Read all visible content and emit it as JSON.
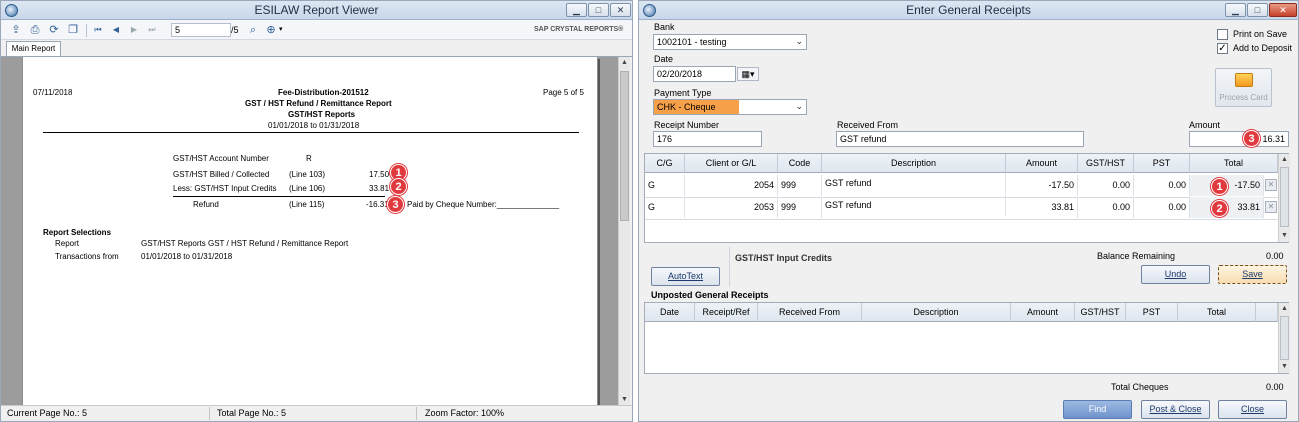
{
  "viewer": {
    "title": "ESILAW Report Viewer",
    "toolbar": {
      "page_input": "5",
      "page_total": "/5",
      "brand": "SAP CRYSTAL REPORTS®"
    },
    "tab": "Main Report",
    "report": {
      "date": "07/11/2018",
      "doc_id": "Fee-Distribution-201512",
      "page_label": "Page 5 of 5",
      "title1": "GST / HST Refund / Remittance  Report",
      "title2": "GST/HST Reports",
      "range": "01/01/2018  to  01/31/2018",
      "account_label": "GST/HST Account Number",
      "account_value": "R",
      "lines": [
        {
          "label": "GST/HST Billed / Collected",
          "line": "(Line 103)",
          "amount": "17.50",
          "badge": "1"
        },
        {
          "label": "Less: GST/HST Input Credits",
          "line": "(Line 106)",
          "amount": "33.81",
          "badge": "2"
        },
        {
          "label": "Refund",
          "line": "(Line 115)",
          "amount": "-16.31",
          "badge": "3"
        }
      ],
      "paid_text": "Paid by Cheque Number:______________",
      "selections_heading": "Report Selections",
      "sel_report_label": "Report",
      "sel_report_value": "GST/HST Reports    GST / HST Refund / Remittance  Report",
      "sel_trans_label": "Transactions from",
      "sel_trans_value": "01/01/2018  to  01/31/2018"
    },
    "status": {
      "current": "Current Page No.: 5",
      "total": "Total Page No.: 5",
      "zoom": "Zoom Factor: 100%"
    }
  },
  "receipts": {
    "title": "Enter General Receipts",
    "bank_label": "Bank",
    "bank_value": "1002101 - testing",
    "date_label": "Date",
    "date_value": "02/20/2018",
    "payment_label": "Payment Type",
    "payment_value": "CHK - Cheque",
    "print_on_save": "Print on Save",
    "add_to_deposit": "Add to Deposit",
    "process_card": "Process Card",
    "receipt_number_label": "Receipt Number",
    "receipt_number_value": "176",
    "received_from_label": "Received From",
    "received_from_value": "GST refund",
    "amount_label": "Amount",
    "amount_value": "16.31",
    "amount_badge": "3",
    "grid": {
      "headers": [
        "C/G",
        "Client or G/L",
        "Code",
        "Description",
        "Amount",
        "GST/HST",
        "PST",
        "Total"
      ],
      "rows": [
        {
          "cg": "G",
          "client": "2054",
          "code": "999",
          "desc": "GST refund",
          "amount": "-17.50",
          "gst": "0.00",
          "pst": "0.00",
          "total": "-17.50",
          "badge": "1"
        },
        {
          "cg": "G",
          "client": "2053",
          "code": "999",
          "desc": "GST refund",
          "amount": "33.81",
          "gst": "0.00",
          "pst": "0.00",
          "total": "33.81",
          "badge": "2"
        }
      ]
    },
    "gst_input_credits": "GST/HST Input Credits",
    "balance_label": "Balance Remaining",
    "balance_value": "0.00",
    "autotext": "AutoText",
    "undo": "Undo",
    "save": "Save",
    "unposted_label": "Unposted General Receipts",
    "unposted_headers": [
      "Date",
      "Receipt/Ref",
      "Received From",
      "Description",
      "Amount",
      "GST/HST",
      "PST",
      "Total"
    ],
    "total_cheques_label": "Total Cheques",
    "total_cheques_value": "0.00",
    "find": "Find",
    "post_close": "Post & Close",
    "close": "Close"
  },
  "colors": {
    "payment_highlight": "#f7a04a",
    "badge": "#e0393e"
  }
}
